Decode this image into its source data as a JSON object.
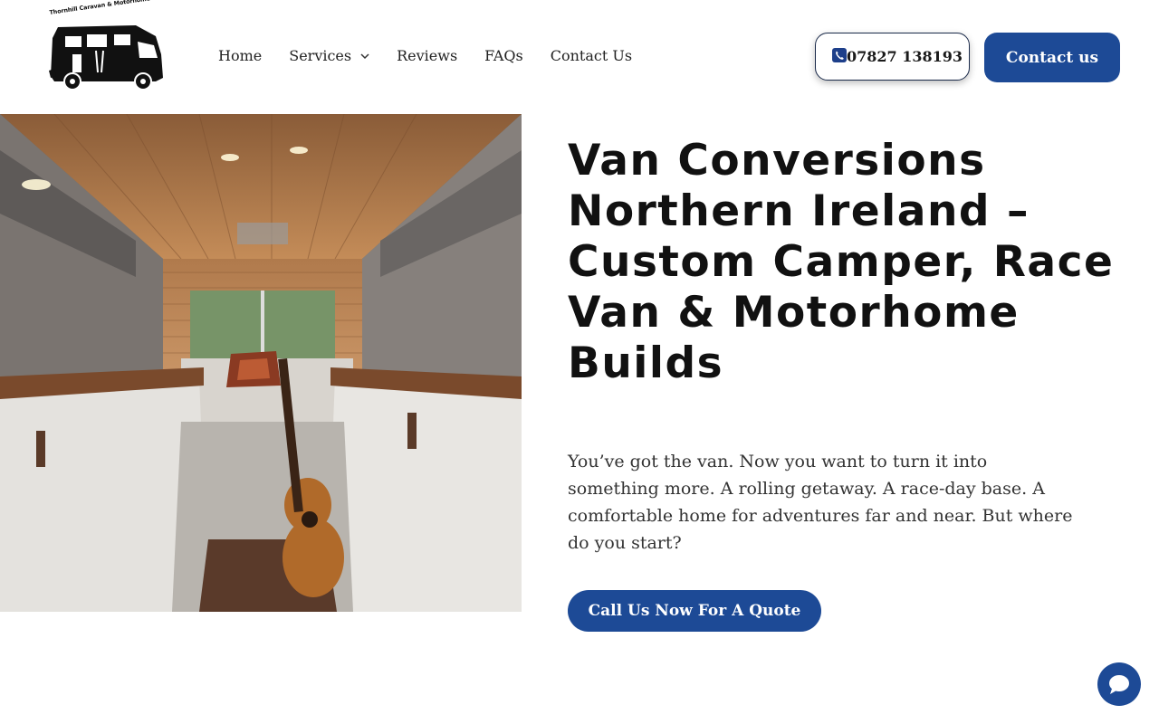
{
  "brand": {
    "logo_text": "Thornhill Caravan & Motorhome Services"
  },
  "nav": {
    "items": [
      {
        "label": "Home"
      },
      {
        "label": "Services"
      },
      {
        "label": "Reviews"
      },
      {
        "label": "FAQs"
      },
      {
        "label": "Contact Us"
      }
    ]
  },
  "header": {
    "phone": "07827 138193",
    "contact_label": "Contact us"
  },
  "hero": {
    "title": "Van Conversions Northern Ireland – Custom Camper, Race Van & Motorhome Builds",
    "paragraph": "You’ve got the van. Now you want to turn it into something more. A rolling getaway. A race-day base. A comfortable home for adventures far and near. But where do you start?",
    "cta_label": "Call Us Now For A Quote"
  },
  "colors": {
    "accent": "#1d4a96",
    "wood": "#a8754a"
  },
  "icons": {
    "phone": "phone-icon",
    "chat": "chat-icon",
    "dropdown": "chevron-down-icon"
  }
}
